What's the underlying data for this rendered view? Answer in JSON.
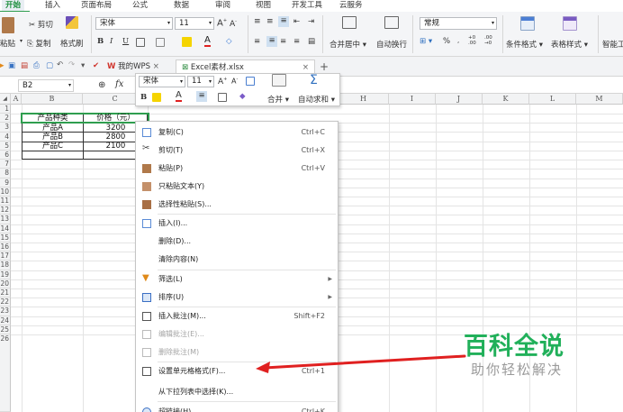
{
  "ribbon_tabs": [
    {
      "label": "开始",
      "active": true
    },
    {
      "label": "插入"
    },
    {
      "label": "页面布局"
    },
    {
      "label": "公式"
    },
    {
      "label": "数据"
    },
    {
      "label": "审阅"
    },
    {
      "label": "视图"
    },
    {
      "label": "开发工具"
    },
    {
      "label": "云服务"
    }
  ],
  "ribbon": {
    "paste": "粘贴",
    "cut": "剪切",
    "copy": "复制",
    "format_painter": "格式刷",
    "font_name": "宋体",
    "font_size": "11",
    "bold": "B",
    "italic": "I",
    "underline": "U",
    "merge_center": "合并居中",
    "auto_wrap": "自动换行",
    "number_format": "常规",
    "percent": "%",
    "thousands": "000",
    "cond_format": "条件格式",
    "table_style": "表格样式",
    "smart_tool": "智能工"
  },
  "quick_access": {
    "wps_tab": "我的WPS",
    "file_tab": "Excel素材.xlsx",
    "close": "×",
    "add": "+"
  },
  "formula_bar": {
    "name_box": "B2",
    "fx": "fx"
  },
  "columns": [
    "A",
    "B",
    "C",
    "D",
    "E",
    "F",
    "G",
    "H",
    "I",
    "J",
    "K",
    "L",
    "M"
  ],
  "rows": [
    "1",
    "2",
    "3",
    "4",
    "5",
    "6",
    "7",
    "8",
    "9",
    "10",
    "11",
    "12",
    "13",
    "14",
    "15",
    "16",
    "17",
    "18",
    "19",
    "20",
    "21",
    "22",
    "23",
    "24",
    "25",
    "26"
  ],
  "sheet": {
    "header": [
      "产品种类",
      "价格（元）"
    ],
    "data": [
      [
        "产品A",
        "3200"
      ],
      [
        "产品B",
        "2800"
      ],
      [
        "产品C",
        "2100"
      ]
    ]
  },
  "mini_toolbar": {
    "font_name": "宋体",
    "font_size": "11",
    "bold": "B",
    "merge": "合并",
    "autosum": "自动求和"
  },
  "context_menu": [
    {
      "label": "复制(C)",
      "shortcut": "Ctrl+C",
      "icon": "copy-icon"
    },
    {
      "label": "剪切(T)",
      "shortcut": "Ctrl+X",
      "icon": "scissors-icon"
    },
    {
      "label": "粘贴(P)",
      "shortcut": "Ctrl+V",
      "icon": "paste-icon"
    },
    {
      "label": "只粘贴文本(Y)",
      "shortcut": "",
      "icon": "paste-text-icon"
    },
    {
      "label": "选择性粘贴(S)...",
      "shortcut": "",
      "icon": "paste-special-icon"
    },
    {
      "label": "插入(I)...",
      "shortcut": "",
      "icon": "insert-icon"
    },
    {
      "label": "删除(D)...",
      "shortcut": "",
      "icon": ""
    },
    {
      "label": "清除内容(N)",
      "shortcut": "",
      "icon": ""
    },
    {
      "label": "筛选(L)",
      "shortcut": "",
      "icon": "filter-icon",
      "submenu": true
    },
    {
      "label": "排序(U)",
      "shortcut": "",
      "icon": "sort-icon",
      "submenu": true
    },
    {
      "label": "插入批注(M)...",
      "shortcut": "Shift+F2",
      "icon": "comment-icon"
    },
    {
      "label": "编辑批注(E)...",
      "shortcut": "",
      "icon": "edit-comment-icon",
      "disabled": true
    },
    {
      "label": "删除批注(M)",
      "shortcut": "",
      "icon": "delete-comment-icon",
      "disabled": true
    },
    {
      "label": "设置单元格格式(F)...",
      "shortcut": "Ctrl+1",
      "icon": "format-cells-icon"
    },
    {
      "label": "从下拉列表中选择(K)...",
      "shortcut": "",
      "icon": ""
    },
    {
      "label": "超链接(H)...",
      "shortcut": "Ctrl+K",
      "icon": "hyperlink-icon"
    }
  ],
  "watermark": {
    "title": "百科全说",
    "subtitle": "助你轻松解决"
  },
  "colors": {
    "accent_green": "#21b05a",
    "selection_border": "#2f9e4f",
    "arrow_red": "#e02020"
  }
}
